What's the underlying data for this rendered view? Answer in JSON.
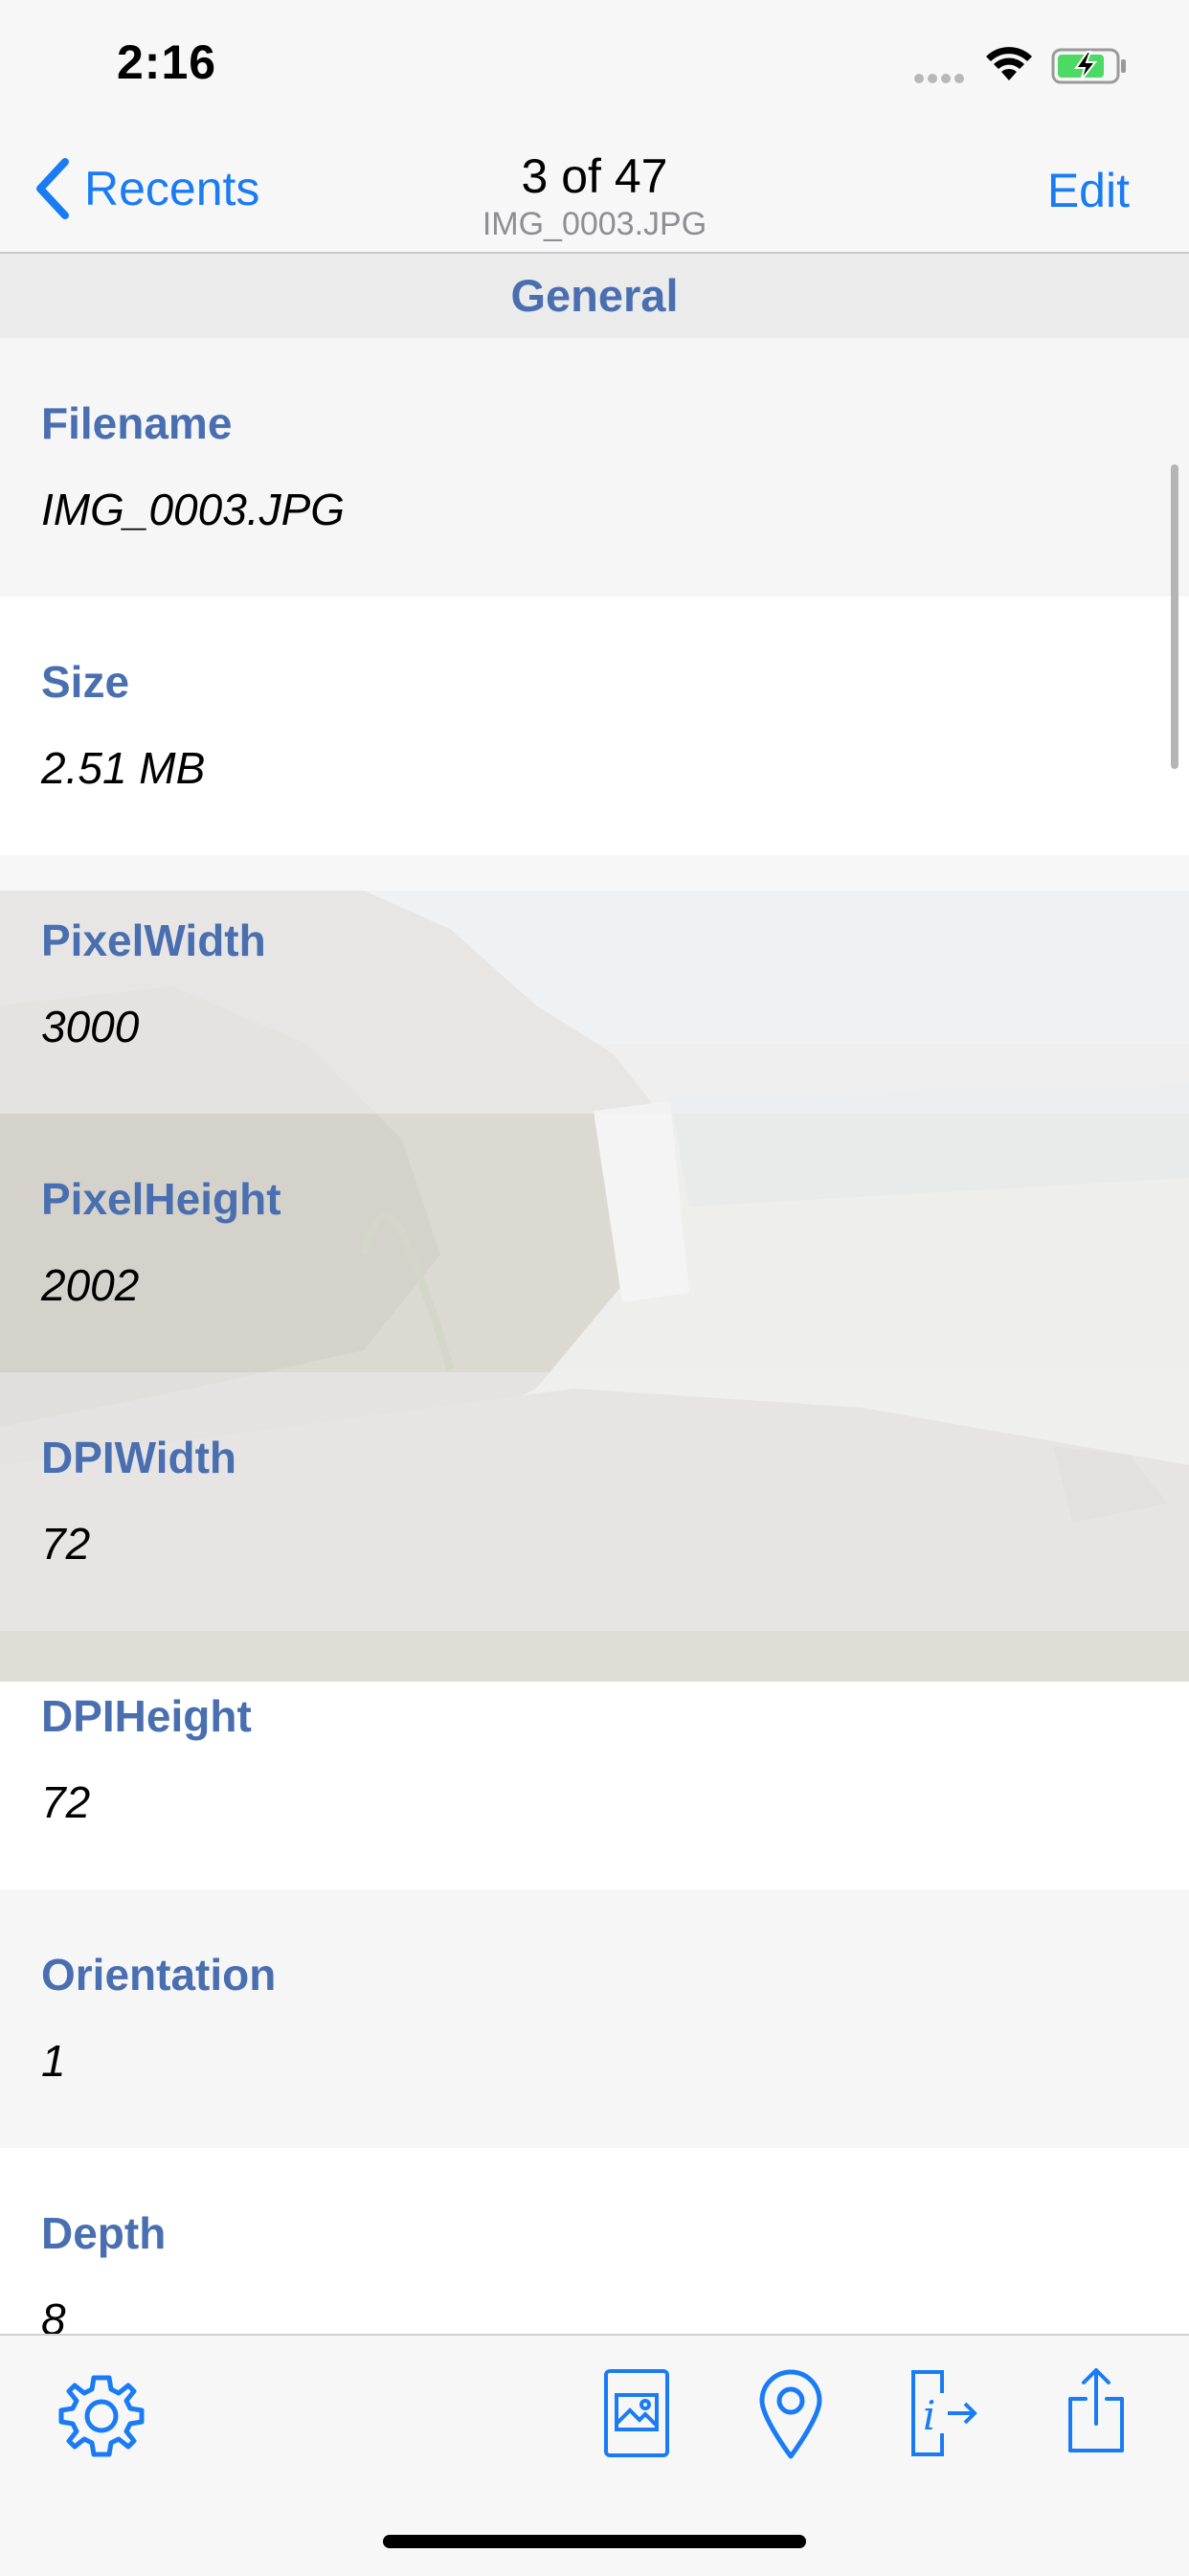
{
  "status_bar": {
    "time": "2:16"
  },
  "nav": {
    "back_label": "Recents",
    "title": "3 of 47",
    "subtitle": "IMG_0003.JPG",
    "edit_label": "Edit"
  },
  "section": {
    "title": "General"
  },
  "rows": [
    {
      "label": "Filename",
      "value": "IMG_0003.JPG"
    },
    {
      "label": "Size",
      "value": "2.51 MB"
    },
    {
      "label": "PixelWidth",
      "value": "3000"
    },
    {
      "label": "PixelHeight",
      "value": "2002"
    },
    {
      "label": "DPIWidth",
      "value": "72"
    },
    {
      "label": "DPIHeight",
      "value": "72"
    },
    {
      "label": "Orientation",
      "value": "1"
    },
    {
      "label": "Depth",
      "value": "8"
    }
  ],
  "toolbar": {
    "icons": [
      "gear-icon",
      "photo-icon",
      "location-pin-icon",
      "info-export-icon",
      "share-icon"
    ]
  },
  "colors": {
    "accent": "#1a7cf5",
    "label": "#4a6fb0",
    "section_bg": "#ebebeb"
  }
}
